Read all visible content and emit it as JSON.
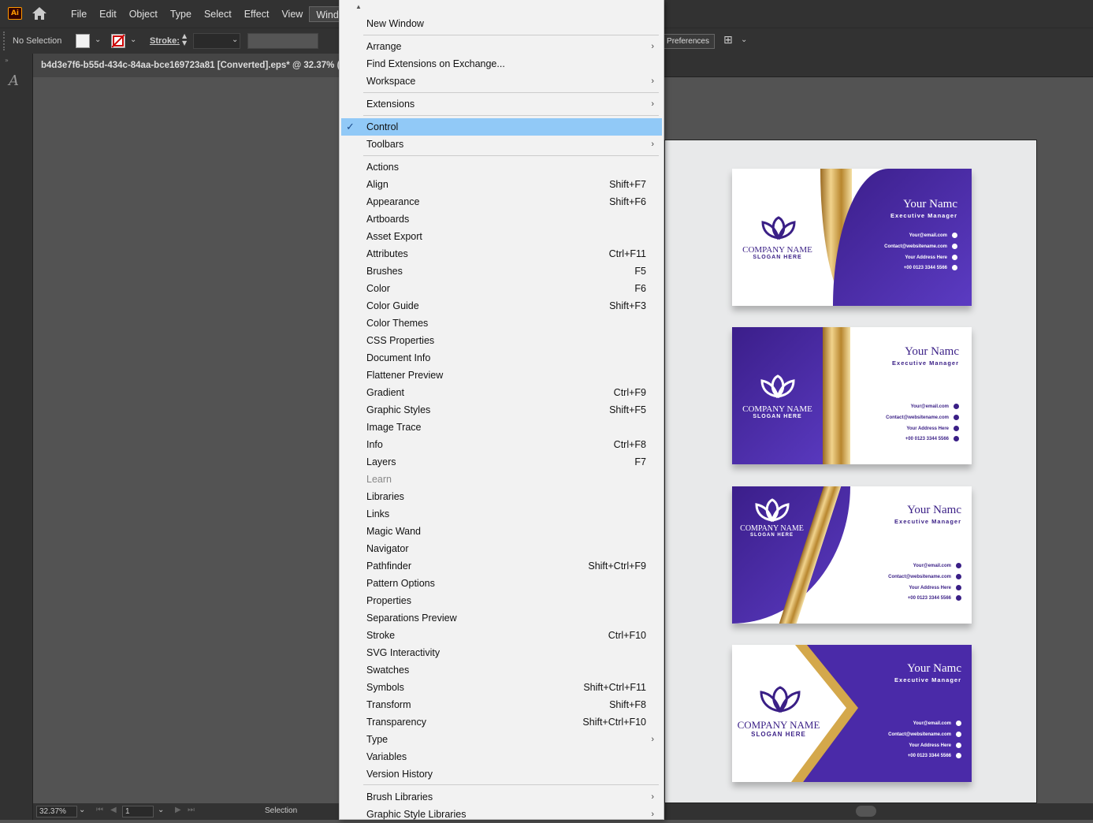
{
  "app": {
    "logo": "Ai",
    "home_icon": "home-icon"
  },
  "menubar": {
    "items": [
      "File",
      "Edit",
      "Object",
      "Type",
      "Select",
      "Effect",
      "View",
      "Window"
    ]
  },
  "control": {
    "selection": "No Selection",
    "stroke_label": "Stroke:",
    "preferences": "Preferences"
  },
  "document": {
    "tab_title": "b4d3e7f6-b55d-434c-84aa-bce169723a81 [Converted].eps* @ 32.37% (RG"
  },
  "status": {
    "zoom": "32.37%",
    "page": "1",
    "tool": "Selection"
  },
  "window_menu": {
    "items": [
      {
        "label": "New Window",
        "shortcut": ""
      },
      {
        "label": "Arrange",
        "shortcut": "",
        "submenu": true
      },
      {
        "label": "Find Extensions on Exchange...",
        "shortcut": ""
      },
      {
        "label": "Workspace",
        "shortcut": "",
        "submenu": true
      },
      {
        "label": "Extensions",
        "shortcut": "",
        "submenu": true
      },
      {
        "label": "Control",
        "shortcut": "",
        "checked": true,
        "selected": true
      },
      {
        "label": "Toolbars",
        "shortcut": "",
        "submenu": true
      },
      {
        "label": "Actions",
        "shortcut": ""
      },
      {
        "label": "Align",
        "shortcut": "Shift+F7"
      },
      {
        "label": "Appearance",
        "shortcut": "Shift+F6"
      },
      {
        "label": "Artboards",
        "shortcut": ""
      },
      {
        "label": "Asset Export",
        "shortcut": ""
      },
      {
        "label": "Attributes",
        "shortcut": "Ctrl+F11"
      },
      {
        "label": "Brushes",
        "shortcut": "F5"
      },
      {
        "label": "Color",
        "shortcut": "F6"
      },
      {
        "label": "Color Guide",
        "shortcut": "Shift+F3"
      },
      {
        "label": "Color Themes",
        "shortcut": ""
      },
      {
        "label": "CSS Properties",
        "shortcut": ""
      },
      {
        "label": "Document Info",
        "shortcut": ""
      },
      {
        "label": "Flattener Preview",
        "shortcut": ""
      },
      {
        "label": "Gradient",
        "shortcut": "Ctrl+F9"
      },
      {
        "label": "Graphic Styles",
        "shortcut": "Shift+F5"
      },
      {
        "label": "Image Trace",
        "shortcut": ""
      },
      {
        "label": "Info",
        "shortcut": "Ctrl+F8"
      },
      {
        "label": "Layers",
        "shortcut": "F7"
      },
      {
        "label": "Learn",
        "shortcut": "",
        "disabled": true
      },
      {
        "label": "Libraries",
        "shortcut": ""
      },
      {
        "label": "Links",
        "shortcut": ""
      },
      {
        "label": "Magic Wand",
        "shortcut": ""
      },
      {
        "label": "Navigator",
        "shortcut": ""
      },
      {
        "label": "Pathfinder",
        "shortcut": "Shift+Ctrl+F9"
      },
      {
        "label": "Pattern Options",
        "shortcut": ""
      },
      {
        "label": "Properties",
        "shortcut": ""
      },
      {
        "label": "Separations Preview",
        "shortcut": ""
      },
      {
        "label": "Stroke",
        "shortcut": "Ctrl+F10"
      },
      {
        "label": "SVG Interactivity",
        "shortcut": ""
      },
      {
        "label": "Swatches",
        "shortcut": ""
      },
      {
        "label": "Symbols",
        "shortcut": "Shift+Ctrl+F11"
      },
      {
        "label": "Transform",
        "shortcut": "Shift+F8"
      },
      {
        "label": "Transparency",
        "shortcut": "Shift+Ctrl+F10"
      },
      {
        "label": "Type",
        "shortcut": "",
        "submenu": true
      },
      {
        "label": "Variables",
        "shortcut": ""
      },
      {
        "label": "Version History",
        "shortcut": ""
      },
      {
        "label": "Brush Libraries",
        "shortcut": "",
        "submenu": true
      },
      {
        "label": "Graphic Style Libraries",
        "shortcut": "",
        "submenu": true
      }
    ]
  },
  "cards": [
    {
      "company": "COMPANY NAME",
      "slogan": "SLOGAN HERE",
      "name": "Your Namc",
      "title": "Executive Manager",
      "email": "Your@email.com",
      "web": "Contact@websitename.com",
      "address": "Your Address Here",
      "phone": "+00 0123  3344  5566"
    },
    {
      "company": "COMPANY NAME",
      "slogan": "SLOGAN HERE",
      "name": "Your Namc",
      "title": "Executive Manager",
      "email": "Your@email.com",
      "web": "Contact@websitename.com",
      "address": "Your Address Here",
      "phone": "+00 0123  3344  5566"
    },
    {
      "company": "COMPANY NAME",
      "slogan": "SLOGAN HERE",
      "name": "Your Namc",
      "title": "Executive Manager",
      "email": "Your@email.com",
      "web": "Contact@websitename.com",
      "address": "Your Address Here",
      "phone": "+00 0123  3344  5566"
    },
    {
      "company": "COMPANY NAME",
      "slogan": "SLOGAN HERE",
      "name": "Your Namc",
      "title": "Executive Manager",
      "email": "Your@email.com",
      "web": "Contact@websitename.com",
      "address": "Your Address Here",
      "phone": "+00 0123  3344  5566"
    }
  ],
  "colors": {
    "accent": "#91c9f7",
    "brand_purple": "#3b1e8a",
    "gold": "#d4a84b"
  }
}
